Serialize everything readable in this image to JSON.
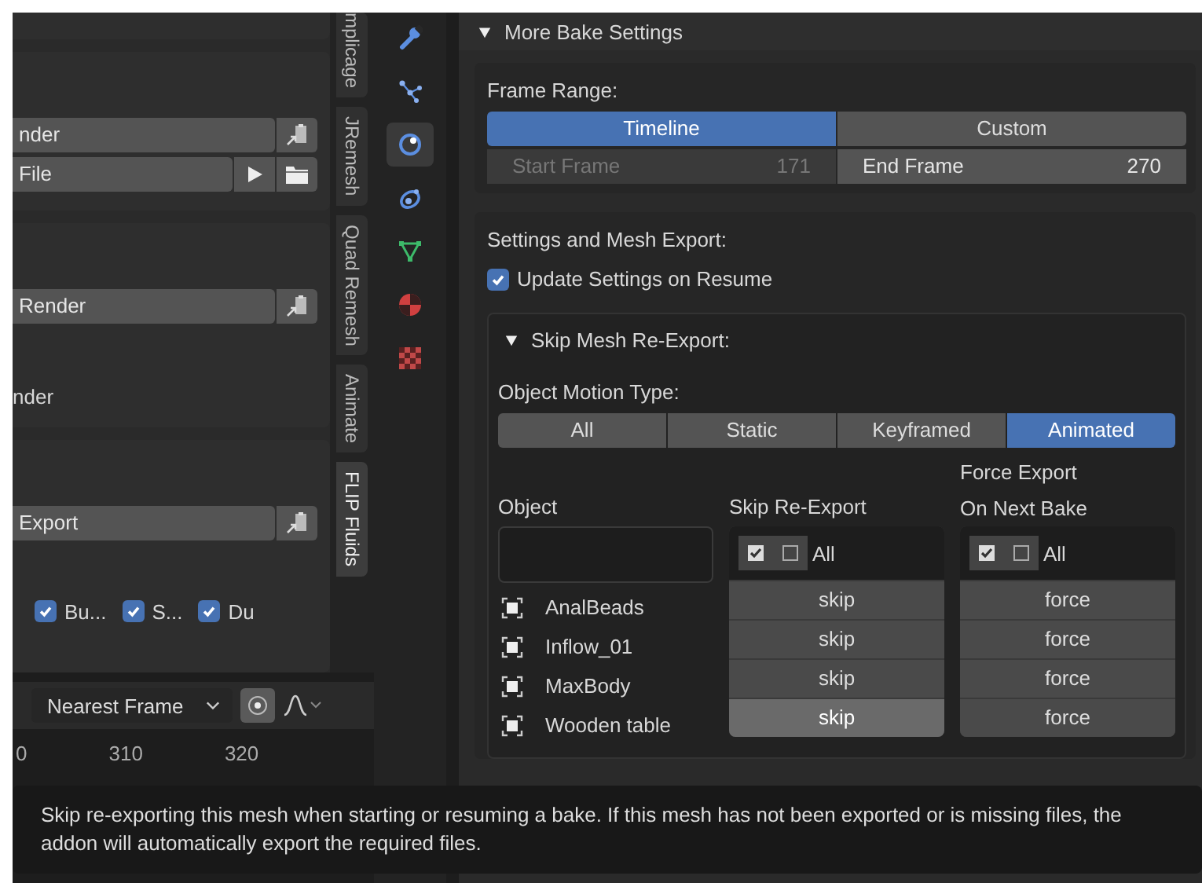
{
  "left_panel": {
    "panel_1": {
      "button": "nder",
      "file_field": "File"
    },
    "panel_2": {
      "button": "Render",
      "label": "nder"
    },
    "panel_3": {
      "button": "Export",
      "checkboxes": [
        {
          "label": "Bu...",
          "checked": true
        },
        {
          "label": "S...",
          "checked": true
        },
        {
          "label": "Du",
          "checked": true
        }
      ]
    }
  },
  "timeline": {
    "interpolation": "Nearest Frame",
    "snap_on": true,
    "ruler": [
      "0",
      "310",
      "320"
    ]
  },
  "side_tabs": [
    {
      "label": "mplicage",
      "selected": false
    },
    {
      "label": "JRemesh",
      "selected": false
    },
    {
      "label": "Quad Remesh",
      "selected": false
    },
    {
      "label": "Animate",
      "selected": false
    },
    {
      "label": "FLIP Fluids",
      "selected": true
    }
  ],
  "property_tabs": [
    {
      "kind": "wrench",
      "selected": false
    },
    {
      "kind": "particles",
      "selected": false
    },
    {
      "kind": "physics",
      "selected": true
    },
    {
      "kind": "constraints",
      "selected": false
    },
    {
      "kind": "mesh",
      "selected": false
    },
    {
      "kind": "material",
      "selected": false
    },
    {
      "kind": "texture",
      "selected": false
    }
  ],
  "more_bake_settings": {
    "title": "More Bake Settings",
    "expanded": true,
    "frame_range": {
      "label": "Frame Range:",
      "modes": [
        {
          "label": "Timeline",
          "selected": true
        },
        {
          "label": "Custom",
          "selected": false
        }
      ],
      "start": {
        "label": "Start Frame",
        "value": "171",
        "disabled": true
      },
      "end": {
        "label": "End Frame",
        "value": "270",
        "disabled": false
      }
    },
    "settings": {
      "label": "Settings and Mesh Export:",
      "update_on_resume": {
        "label": "Update Settings on Resume",
        "checked": true
      }
    },
    "skip_mesh": {
      "title": "Skip Mesh Re-Export:",
      "expanded": true,
      "motion_label": "Object Motion Type:",
      "motion_types": [
        {
          "label": "All",
          "selected": false
        },
        {
          "label": "Static",
          "selected": false
        },
        {
          "label": "Keyframed",
          "selected": false
        },
        {
          "label": "Animated",
          "selected": true
        }
      ],
      "columns": {
        "object": "Object",
        "skip": "Skip Re-Export",
        "force": [
          "Force Export",
          "On Next Bake"
        ]
      },
      "skip_all": "All",
      "force_all": "All",
      "objects": [
        {
          "name": "AnalBeads",
          "skip": "skip",
          "force": "force",
          "hovered": false
        },
        {
          "name": "Inflow_01",
          "skip": "skip",
          "force": "force",
          "hovered": false
        },
        {
          "name": "MaxBody",
          "skip": "skip",
          "force": "force",
          "hovered": false
        },
        {
          "name": "Wooden table",
          "skip": "skip",
          "force": "force",
          "hovered": true
        }
      ]
    }
  },
  "tooltip": "Skip re-exporting this mesh when starting or resuming a bake. If this mesh has not been exported or is missing files, the addon will automatically export the required files."
}
